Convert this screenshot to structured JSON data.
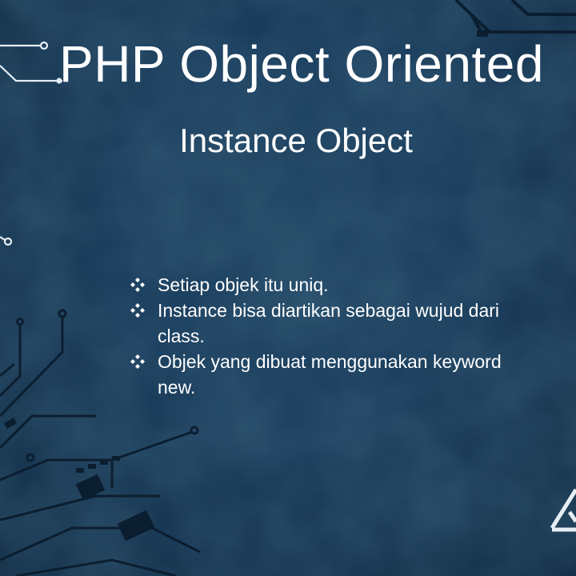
{
  "slide": {
    "title": "PHP Object Oriented",
    "subtitle": "Instance Object",
    "bullets": [
      {
        "icon": "four-diamond-bullet-icon",
        "text": "Setiap objek itu uniq."
      },
      {
        "icon": "four-diamond-bullet-icon",
        "text": "Instance bisa diartikan sebagai wujud dari class."
      },
      {
        "icon": "four-diamond-bullet-icon",
        "text": "Objek yang dibuat menggunakan keyword new."
      }
    ]
  },
  "colors": {
    "background": "#17395a",
    "text": "#ffffff",
    "circuit_lines": "#0b1e30",
    "circuit_highlight": "#e6eef5"
  }
}
